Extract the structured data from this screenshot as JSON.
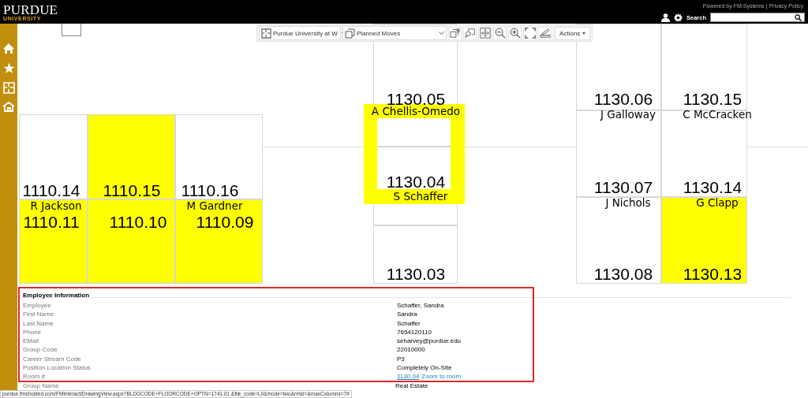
{
  "header": {
    "logo": "PURDUE",
    "logo_sub": "UNIVERSITY",
    "links": [
      "Powered by FM:Systems",
      "Privacy Policy"
    ],
    "link_separator": "|",
    "search": {
      "label": "Search"
    }
  },
  "sidebar": {
    "items": [
      {
        "kind": "home"
      },
      {
        "kind": "star"
      },
      {
        "kind": "floorplan"
      },
      {
        "kind": "building"
      }
    ]
  },
  "toolbar": {
    "site": "Purdue University at W",
    "layer": "Planned Moves",
    "tools": [
      {
        "kind": "layers"
      },
      {
        "kind": "zoom-window"
      },
      {
        "kind": "zoom-extents"
      },
      {
        "kind": "zoom-out"
      },
      {
        "kind": "zoom-in"
      },
      {
        "kind": "fullscreen"
      },
      {
        "kind": "measure"
      }
    ],
    "actions": "Actions"
  },
  "rooms": [
    {
      "number": "1110.14",
      "occupant": "R Jackson",
      "highlighted": false,
      "selected": false
    },
    {
      "number": "1110.15",
      "highlighted": true,
      "selected": false
    },
    {
      "number": "1110.16",
      "occupant": "M Gardner",
      "highlighted": false,
      "selected": false
    },
    {
      "number": "1110.11",
      "highlighted": true,
      "selected": false
    },
    {
      "number": "1110.10",
      "highlighted": true,
      "selected": false
    },
    {
      "number": "1110.09",
      "highlighted": true,
      "selected": false
    },
    {
      "number": "1130.05",
      "occupant": "A Chellis-Omedo",
      "highlighted": false,
      "selected": false
    },
    {
      "number": "1130.04",
      "occupant": "S Schaffer",
      "highlighted": false,
      "selected": true
    },
    {
      "number": "1130.03",
      "highlighted": false,
      "selected": false
    },
    {
      "number": "1130.06",
      "occupant": "J Galloway",
      "highlighted": false,
      "selected": false
    },
    {
      "number": "1130.15",
      "occupant": "C McCracken",
      "highlighted": false,
      "selected": false
    },
    {
      "number": "1130.07",
      "occupant": "J Nichols",
      "highlighted": false,
      "selected": false
    },
    {
      "number": "1130.14",
      "occupant": "G Clapp",
      "highlighted": false,
      "selected": false
    },
    {
      "number": "1130.08",
      "highlighted": false,
      "selected": false
    },
    {
      "number": "1130.13",
      "highlighted": true,
      "selected": false
    }
  ],
  "info_panel": {
    "title": "Employee Information",
    "rows": [
      {
        "label": "Employee",
        "value": "Schaffer, Sandra"
      },
      {
        "label": "First Name",
        "value": "Sandra"
      },
      {
        "label": "Last Name",
        "value": "Schaffer"
      },
      {
        "label": "Phone",
        "value": "7654120110"
      },
      {
        "label": "EMail",
        "value": "seharvey@purdue.edu"
      },
      {
        "label": "Group Code",
        "value": "22010000"
      },
      {
        "label": "Career Stream Code",
        "value": "P3"
      },
      {
        "label": "Position Location Status",
        "value": "Completely On-Site"
      },
      {
        "label": "Room #",
        "value": "1130.04",
        "link": "Zoom to room"
      }
    ],
    "after_rows": [
      {
        "label": "Group Name",
        "value": "Real Estate"
      }
    ]
  },
  "status_bar": {
    "url": "purdue.fmshosted.com/FMInteract/DrawingView.aspx?BLDGCODE+FLOORCODE+OPTN=1741.01 &file_code=L0&mode=two&rmid=&maxColumns=7#"
  }
}
